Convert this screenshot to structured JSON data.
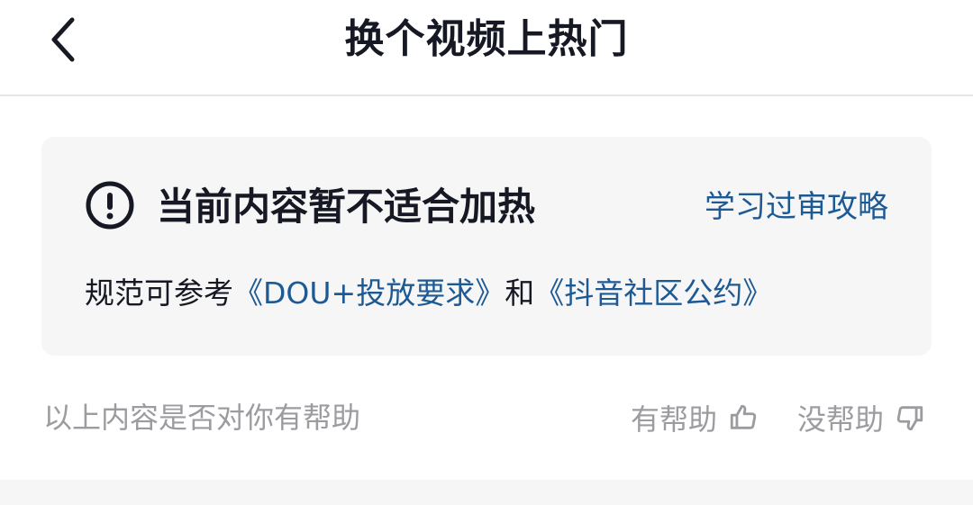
{
  "header": {
    "back_icon": "chevron-left-icon",
    "title": "换个视频上热门"
  },
  "notice": {
    "icon": "exclamation-circle-icon",
    "title": "当前内容暂不适合加热",
    "link_label": "学习过审攻略",
    "desc_prefix": "规范可参考",
    "desc_link1": "《DOU+投放要求》",
    "desc_mid": "和",
    "desc_link2": "《抖音社区公约》"
  },
  "feedback": {
    "question": "以上内容是否对你有帮助",
    "helpful_label": "有帮助",
    "helpful_icon": "thumbs-up-icon",
    "unhelpful_label": "没帮助",
    "unhelpful_icon": "thumbs-down-icon"
  },
  "colors": {
    "link": "#1d5a94",
    "muted": "#9c9ca0",
    "text": "#161823",
    "card_bg": "#f6f6f7"
  }
}
